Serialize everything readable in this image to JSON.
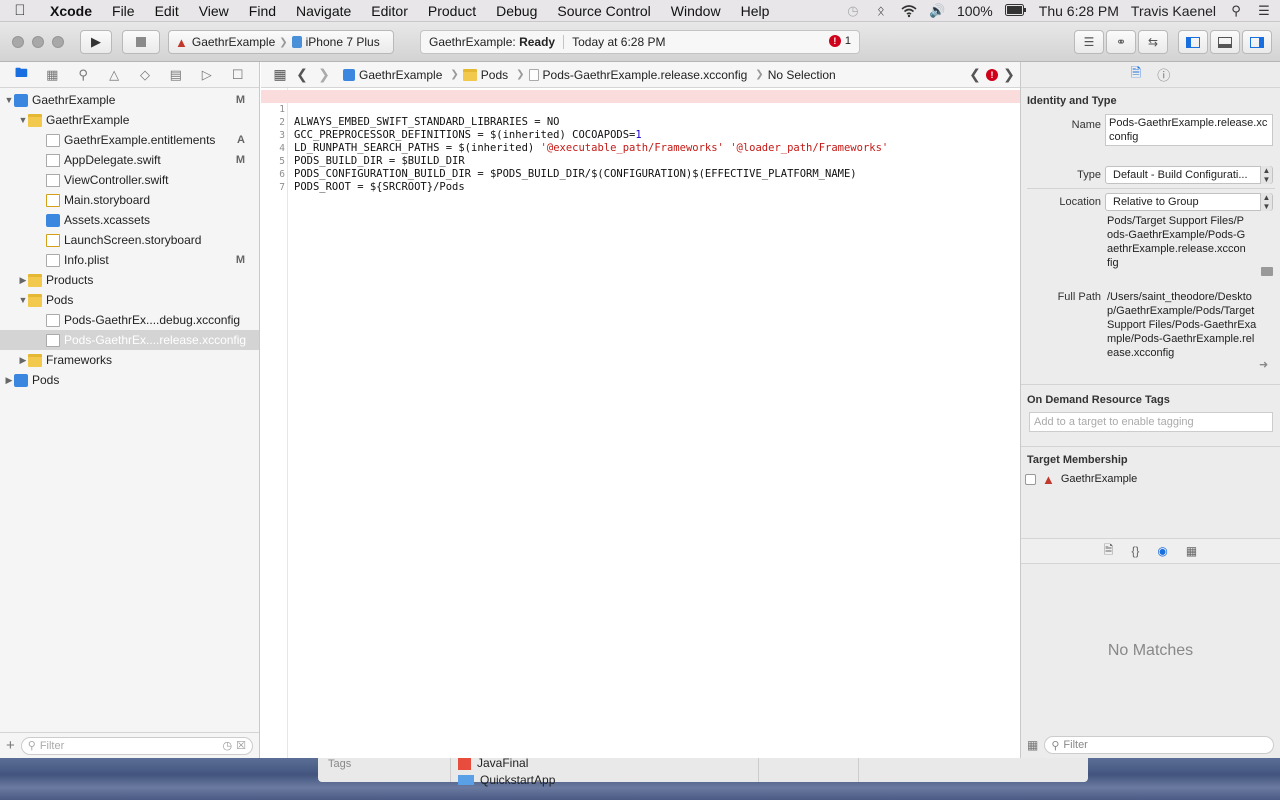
{
  "menubar": {
    "items": [
      "Xcode",
      "File",
      "Edit",
      "View",
      "Find",
      "Navigate",
      "Editor",
      "Product",
      "Debug",
      "Source Control",
      "Window",
      "Help"
    ],
    "battery": "100%",
    "clock": "Thu 6:28 PM",
    "user": "Travis Kaenel"
  },
  "toolbar": {
    "scheme": "GaethrExample",
    "destination": "iPhone 7 Plus",
    "activity_project": "GaethrExample:",
    "activity_status": "Ready",
    "activity_time": "Today at 6:28 PM",
    "error_count": "1"
  },
  "navigator": {
    "rows": [
      {
        "label": "GaethrExample",
        "status": "M"
      },
      {
        "label": "GaethrExample",
        "status": ""
      },
      {
        "label": "GaethrExample.entitlements",
        "status": "A"
      },
      {
        "label": "AppDelegate.swift",
        "status": "M"
      },
      {
        "label": "ViewController.swift",
        "status": ""
      },
      {
        "label": "Main.storyboard",
        "status": ""
      },
      {
        "label": "Assets.xcassets",
        "status": ""
      },
      {
        "label": "LaunchScreen.storyboard",
        "status": ""
      },
      {
        "label": "Info.plist",
        "status": "M"
      },
      {
        "label": "Products",
        "status": ""
      },
      {
        "label": "Pods",
        "status": ""
      },
      {
        "label": "Pods-GaethrEx....debug.xcconfig",
        "status": ""
      },
      {
        "label": "Pods-GaethrEx....release.xcconfig",
        "status": ""
      },
      {
        "label": "Frameworks",
        "status": ""
      },
      {
        "label": "Pods",
        "status": ""
      }
    ],
    "filter_placeholder": "Filter"
  },
  "jumpbar": {
    "crumbs": [
      "GaethrExample",
      "Pods",
      "Pods-GaethrExample.release.xcconfig",
      "No Selection"
    ]
  },
  "editor": {
    "lines": [
      "ALWAYS_EMBED_SWIFT_STANDARD_LIBRARIES = NO",
      "GCC_PREPROCESSOR_DEFINITIONS = $(inherited) COCOAPODS=",
      "LD_RUNPATH_SEARCH_PATHS = $(inherited) ",
      "PODS_BUILD_DIR = $BUILD_DIR",
      "PODS_CONFIGURATION_BUILD_DIR = $PODS_BUILD_DIR/$(CONFIGURATION)$(EFFECTIVE_PLATFORM_NAME)",
      "PODS_ROOT = ${SRCROOT}/Pods",
      ""
    ],
    "line2_number_literal": "1",
    "line3_strings": "'@executable_path/Frameworks' '@loader_path/Frameworks'"
  },
  "inspector": {
    "identity_title": "Identity and Type",
    "name_label": "Name",
    "name_value": "Pods-GaethrExample.release.xcconfig",
    "type_label": "Type",
    "type_value": "Default - Build Configurati...",
    "location_label": "Location",
    "location_value": "Relative to Group",
    "location_path": "Pods/Target Support Files/Pods-GaethrExample/Pods-GaethrExample.release.xcconfig",
    "fullpath_label": "Full Path",
    "fullpath_value": "/Users/saint_theodore/Desktop/GaethrExample/Pods/Target Support Files/Pods-GaethrExample/Pods-GaethrExample.release.xcconfig",
    "odr_title": "On Demand Resource Tags",
    "odr_placeholder": "Add to a target to enable tagging",
    "membership_title": "Target Membership",
    "membership_target": "GaethrExample",
    "no_matches": "No Matches",
    "filter_placeholder": "Filter"
  },
  "background_window": {
    "col_label": "Tags",
    "items": [
      "JavaFinal",
      "QuickstartApp"
    ]
  },
  "colors": {
    "accent": "#1a6fe0",
    "error": "#d0021b",
    "error_line": "#fadcdc",
    "string": "#c41a16",
    "number": "#1c00cf"
  }
}
